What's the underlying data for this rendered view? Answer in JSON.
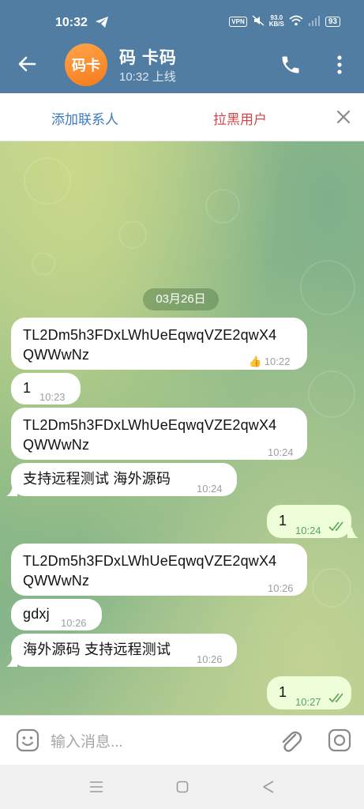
{
  "status_bar": {
    "time": "10:32",
    "vpn": "VPN",
    "speed_value": "93.0",
    "speed_unit": "KB/S",
    "battery": "93"
  },
  "header": {
    "avatar_text": "码卡",
    "contact_name": "码 卡码",
    "last_seen": "10:32 上线"
  },
  "actions": {
    "add_contact": "添加联系人",
    "block_user": "拉黑用户"
  },
  "chat": {
    "date_label": "03月26日",
    "messages": [
      {
        "dir": "in",
        "line1": "TL2Dm5h3FDxLWhUeEqwqVZE2qwX4",
        "line2": "QWWwNz",
        "reaction": "👍",
        "time": "10:22"
      },
      {
        "dir": "in",
        "line1": "1",
        "time": "10:23"
      },
      {
        "dir": "in",
        "line1": "TL2Dm5h3FDxLWhUeEqwqVZE2qwX4",
        "line2": "QWWwNz",
        "time": "10:24"
      },
      {
        "dir": "in",
        "line1": "支持远程测试 海外源码",
        "time": "10:24"
      },
      {
        "dir": "out",
        "line1": "1",
        "time": "10:24"
      },
      {
        "dir": "in",
        "line1": "TL2Dm5h3FDxLWhUeEqwqVZE2qwX4",
        "line2": "QWWwNz",
        "time": "10:26"
      },
      {
        "dir": "in",
        "line1": "gdxj",
        "time": "10:26"
      },
      {
        "dir": "in",
        "line1": "海外源码 支持远程测试",
        "time": "10:26"
      },
      {
        "dir": "out",
        "line1": "1",
        "time": "10:27"
      }
    ]
  },
  "input": {
    "placeholder": "输入消息..."
  },
  "colors": {
    "header": "#517da2",
    "outgoing_bubble": "#eefed9",
    "incoming_bubble": "#ffffff",
    "accent_blue": "#3a7cbf",
    "accent_red": "#d04848",
    "avatar_orange": "#f67b1a"
  },
  "icons": [
    "telegram-send-icon",
    "back-arrow-icon",
    "phone-icon",
    "more-vert-icon",
    "close-icon",
    "emoji-icon",
    "paperclip-icon",
    "camera-icon",
    "nav-menu-icon",
    "nav-home-icon",
    "nav-back-icon",
    "double-check-icon"
  ]
}
